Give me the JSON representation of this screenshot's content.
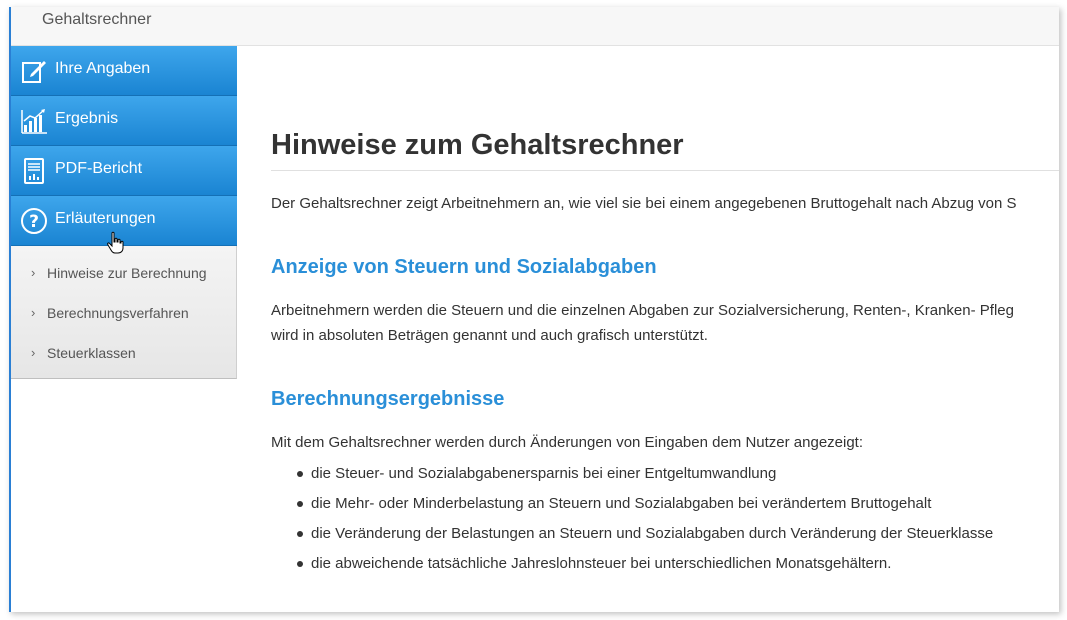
{
  "app": {
    "title": "Gehaltsrechner"
  },
  "sidebar": {
    "items": [
      {
        "label": "Ihre Angaben",
        "icon": "edit-form-icon"
      },
      {
        "label": "Ergebnis",
        "icon": "bar-chart-icon"
      },
      {
        "label": "PDF-Bericht",
        "icon": "report-document-icon"
      },
      {
        "label": "Erläuterungen",
        "icon": "question-icon"
      }
    ],
    "subitems": [
      {
        "label": "Hinweise zur Berechnung"
      },
      {
        "label": "Berechnungsverfahren"
      },
      {
        "label": "Steuerklassen"
      }
    ]
  },
  "main": {
    "title": "Hinweise zum Gehaltsrechner",
    "intro": "Der Gehaltsrechner zeigt Arbeitnehmern an, wie viel sie bei einem angegebenen Bruttogehalt nach Abzug von S",
    "section1": {
      "heading": "Anzeige von Steuern und Sozialabgaben",
      "line1": "Arbeitnehmern werden die Steuern und die einzelnen Abgaben zur Sozialversicherung, Renten-, Kranken- Pfleg",
      "line2": "wird in absoluten Beträgen genannt und auch grafisch unterstützt."
    },
    "section2": {
      "heading": "Berechnungsergebnisse",
      "intro": "Mit dem Gehaltsrechner werden durch Änderungen von Eingaben dem Nutzer angezeigt:",
      "bullets": [
        "die Steuer- und Sozialabgabenersparnis bei einer Entgeltumwandlung",
        "die Mehr- oder Minderbelastung an Steuern und Sozialabgaben bei verändertem Bruttogehalt",
        "die Veränderung der Belastungen an Steuern und Sozialabgaben durch Veränderung der Steuerklasse",
        "die abweichende tatsächliche Jahreslohnsteuer bei unterschiedlichen Monatsgehältern."
      ]
    }
  },
  "colors": {
    "accent": "#1a84d2",
    "heading": "#2a8fd8"
  }
}
